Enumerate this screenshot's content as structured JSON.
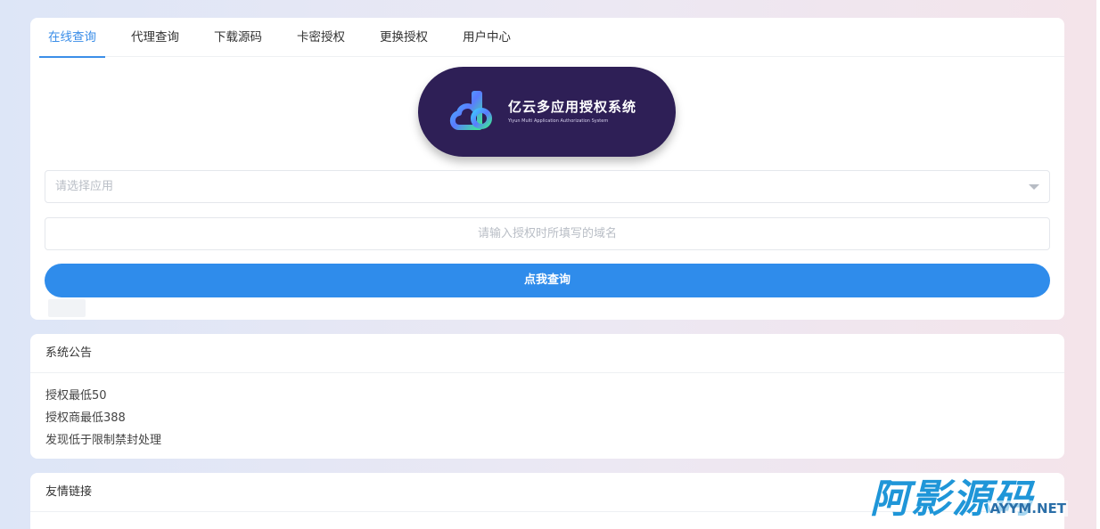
{
  "tabs": [
    {
      "label": "在线查询",
      "active": true
    },
    {
      "label": "代理查询",
      "active": false
    },
    {
      "label": "下载源码",
      "active": false
    },
    {
      "label": "卡密授权",
      "active": false
    },
    {
      "label": "更换授权",
      "active": false
    },
    {
      "label": "用户中心",
      "active": false
    }
  ],
  "logo": {
    "title": "亿云多应用授权系统",
    "subtitle": "Yiyun Multi Application Authorization System"
  },
  "form": {
    "app_select_placeholder": "请选择应用",
    "domain_placeholder": "请输入授权时所填写的域名",
    "submit_label": "点我查询"
  },
  "notice": {
    "title": "系统公告",
    "lines": [
      "授权最低50",
      "授权商最低388",
      "发现低于限制禁封处理"
    ]
  },
  "links": {
    "title": "友情链接"
  },
  "watermark": {
    "main": "阿影源码",
    "sub": "AYYM.NET"
  },
  "colors": {
    "accent": "#2f8ceb",
    "logo_bg": "#2e1f56",
    "watermark": "#1f96d8"
  }
}
